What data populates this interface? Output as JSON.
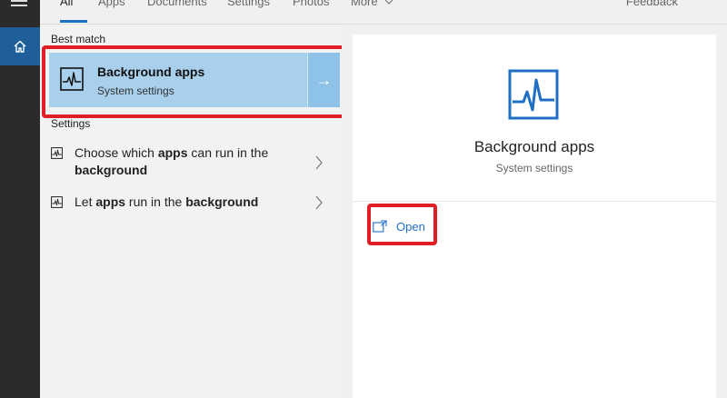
{
  "tabs": [
    {
      "label": "All",
      "active": true
    },
    {
      "label": "Apps"
    },
    {
      "label": "Documents"
    },
    {
      "label": "Settings"
    },
    {
      "label": "Photos"
    },
    {
      "label": "More"
    }
  ],
  "feedback_label": "Feedback",
  "sections": {
    "best_match": "Best match",
    "settings": "Settings"
  },
  "best_match": {
    "title": "Background apps",
    "subtitle": "System settings",
    "arrow": "→",
    "icon": "activity-chart-icon"
  },
  "settings_results": [
    {
      "prefix": "Choose which ",
      "bold": "apps",
      "middle": " can run in the ",
      "bold2": "background"
    },
    {
      "prefix": "Let ",
      "bold": "apps",
      "middle": " run in the ",
      "bold2": "background"
    }
  ],
  "detail": {
    "title": "Background apps",
    "subtitle": "System settings",
    "open_label": "Open"
  },
  "colors": {
    "accent": "#1f6fc5",
    "highlight": "#e01e26",
    "best_match_bg": "#a8d0ec"
  }
}
